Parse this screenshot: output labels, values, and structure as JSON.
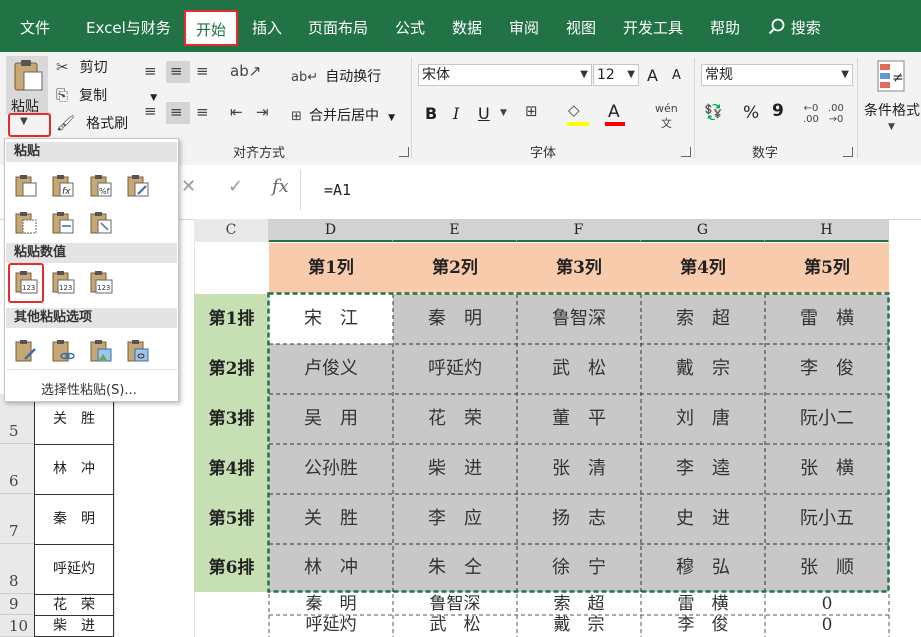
{
  "menu": {
    "items": [
      "文件",
      "Excel与财务",
      "开始",
      "插入",
      "页面布局",
      "公式",
      "数据",
      "审阅",
      "视图",
      "开发工具",
      "帮助"
    ],
    "search_label": "搜索"
  },
  "ribbon": {
    "paste_label": "粘贴",
    "cut_label": "剪切",
    "copy_label": "复制",
    "format_painter_label": "格式刷",
    "wrap_text_label": "自动换行",
    "merge_center_label": "合并后居中",
    "alignment_group": "对齐方式",
    "font_name": "宋体",
    "font_size": "12",
    "bold": "B",
    "italic": "I",
    "underline": "U",
    "font_color_letter": "A",
    "font_group": "字体",
    "number_format": "常规",
    "number_group": "数字",
    "conditional_format_label": "条件格式",
    "percent": "%",
    "comma": "9",
    "font_inc": "A",
    "font_dec": "A"
  },
  "formula_bar": {
    "fx_label": "fx",
    "formula": "=A1"
  },
  "paste_menu": {
    "section_paste": "粘贴",
    "section_paste_values": "粘贴数值",
    "section_other": "其他粘贴选项",
    "paste_special": "选择性粘贴(S)..."
  },
  "grid": {
    "columns": [
      "C",
      "D",
      "E",
      "F",
      "G",
      "H"
    ],
    "header_row": [
      "第1列",
      "第2列",
      "第3列",
      "第4列",
      "第5列"
    ],
    "row_labels": [
      "第1排",
      "第2排",
      "第3排",
      "第4排",
      "第5排",
      "第6排"
    ],
    "rows": [
      [
        "宋　江",
        "秦　明",
        "鲁智深",
        "索　超",
        "雷　横"
      ],
      [
        "卢俊义",
        "呼延灼",
        "武　松",
        "戴　宗",
        "李　俊"
      ],
      [
        "吴　用",
        "花　荣",
        "董　平",
        "刘　唐",
        "阮小二"
      ],
      [
        "公孙胜",
        "柴　进",
        "张　清",
        "李　逵",
        "张　横"
      ],
      [
        "关　胜",
        "李　应",
        "扬　志",
        "史　进",
        "阮小五"
      ],
      [
        "林　冲",
        "朱　仝",
        "徐　宁",
        "穆　弘",
        "张　顺"
      ]
    ],
    "row_numbers": [
      "5",
      "6",
      "7",
      "8",
      "9",
      "10"
    ],
    "left_column": [
      "关　胜",
      "林　冲",
      "秦　明",
      "呼延灼",
      "花　荣",
      "柴　进"
    ],
    "extra_rows": [
      [
        "秦　明",
        "鲁智深",
        "索　超",
        "雷　横",
        "0"
      ],
      [
        "呼延灼",
        "武　松",
        "戴　宗",
        "李　俊",
        "0"
      ]
    ]
  },
  "colors": {
    "accent": "#217346",
    "highlight": "#e52b2b",
    "header_fill": "#f8cbad",
    "label_fill": "#c6e0b4",
    "selection_fill": "#c8c8c8"
  }
}
